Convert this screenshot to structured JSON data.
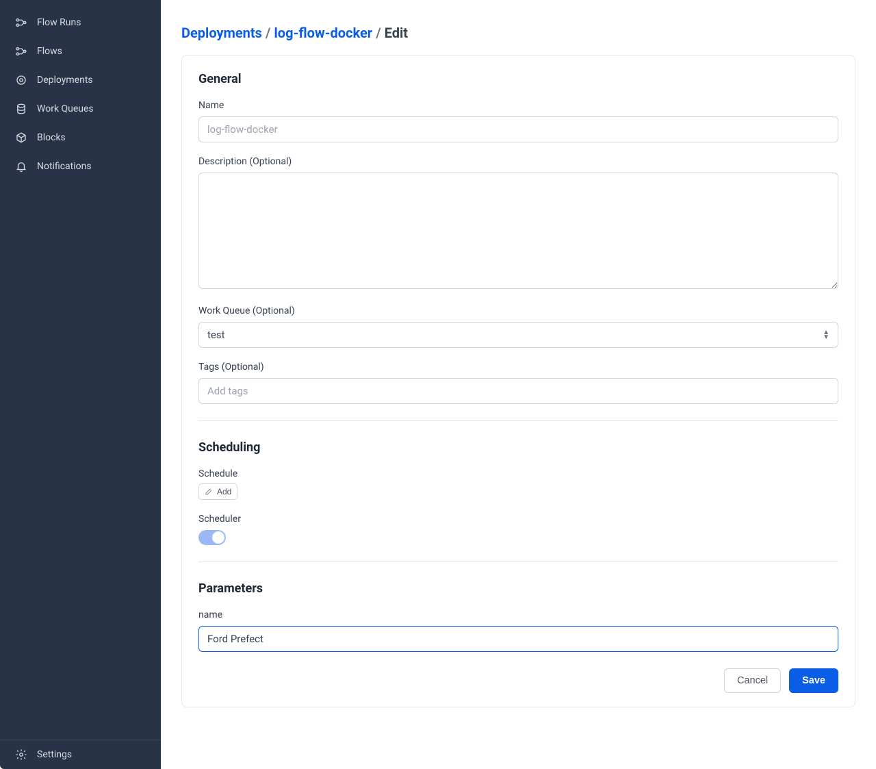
{
  "sidebar": {
    "items": [
      {
        "label": "Flow Runs"
      },
      {
        "label": "Flows"
      },
      {
        "label": "Deployments"
      },
      {
        "label": "Work Queues"
      },
      {
        "label": "Blocks"
      },
      {
        "label": "Notifications"
      }
    ],
    "settings_label": "Settings"
  },
  "breadcrumb": {
    "root": "Deployments",
    "item": "log-flow-docker",
    "current": "Edit",
    "sep": "/"
  },
  "sections": {
    "general": {
      "title": "General",
      "name_label": "Name",
      "name_placeholder": "log-flow-docker",
      "description_label": "Description (Optional)",
      "work_queue_label": "Work Queue (Optional)",
      "work_queue_value": "test",
      "tags_label": "Tags (Optional)",
      "tags_placeholder": "Add tags"
    },
    "scheduling": {
      "title": "Scheduling",
      "schedule_label": "Schedule",
      "add_button": "Add",
      "scheduler_label": "Scheduler"
    },
    "parameters": {
      "title": "Parameters",
      "name_label": "name",
      "name_value": "Ford Prefect"
    }
  },
  "actions": {
    "cancel": "Cancel",
    "save": "Save"
  }
}
